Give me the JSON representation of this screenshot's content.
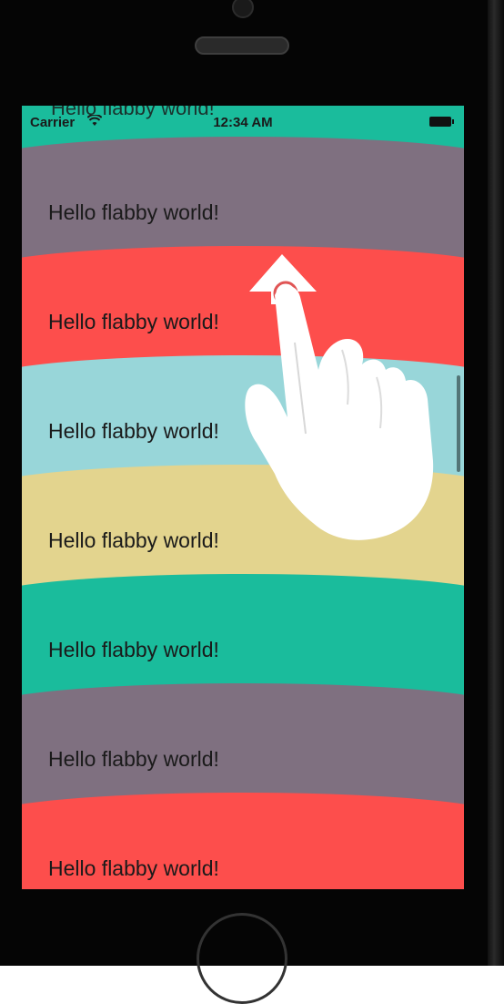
{
  "status_bar": {
    "carrier": "Carrier",
    "wifi_icon": "wifi-icon",
    "time": "12:34 AM",
    "battery_icon": "battery-icon"
  },
  "ghost_row_label": "Hello flabby world!",
  "cells": [
    {
      "label": "Hello flabby world!",
      "color": "#7f7080"
    },
    {
      "label": "Hello flabby world!",
      "color": "#fd4e4c"
    },
    {
      "label": "Hello flabby world!",
      "color": "#98d6d9"
    },
    {
      "label": "Hello flabby world!",
      "color": "#e3d48e"
    },
    {
      "label": "Hello flabby world!",
      "color": "#1abc9c"
    },
    {
      "label": "Hello flabby world!",
      "color": "#7f7080"
    },
    {
      "label": "Hello flabby world!",
      "color": "#fd4e4c"
    }
  ],
  "top_cell_color": "#1abc9c",
  "gesture": {
    "icon": "swipe-up-hand-icon",
    "direction": "up"
  }
}
